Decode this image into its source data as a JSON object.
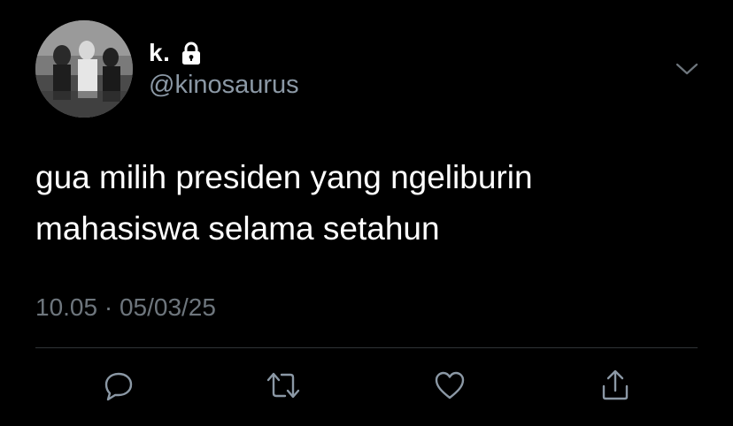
{
  "author": {
    "display_name": "k.",
    "handle": "@kinosaurus",
    "protected": true,
    "avatar_icon": "profile-photo"
  },
  "tweet": {
    "text": "gua milih presiden yang ngeliburin\nmahasiswa selama setahun",
    "timestamp": "10.05 · 05/03/25"
  },
  "icons": {
    "lock": "lock-icon",
    "more": "chevron-down-icon",
    "reply": "reply-icon",
    "retweet": "retweet-icon",
    "like": "heart-icon",
    "share": "share-icon"
  },
  "colors": {
    "background": "#000000",
    "text_primary": "#ffffff",
    "text_secondary": "#8b98a5",
    "icon": "#8b98a5",
    "divider": "#2f3336"
  }
}
